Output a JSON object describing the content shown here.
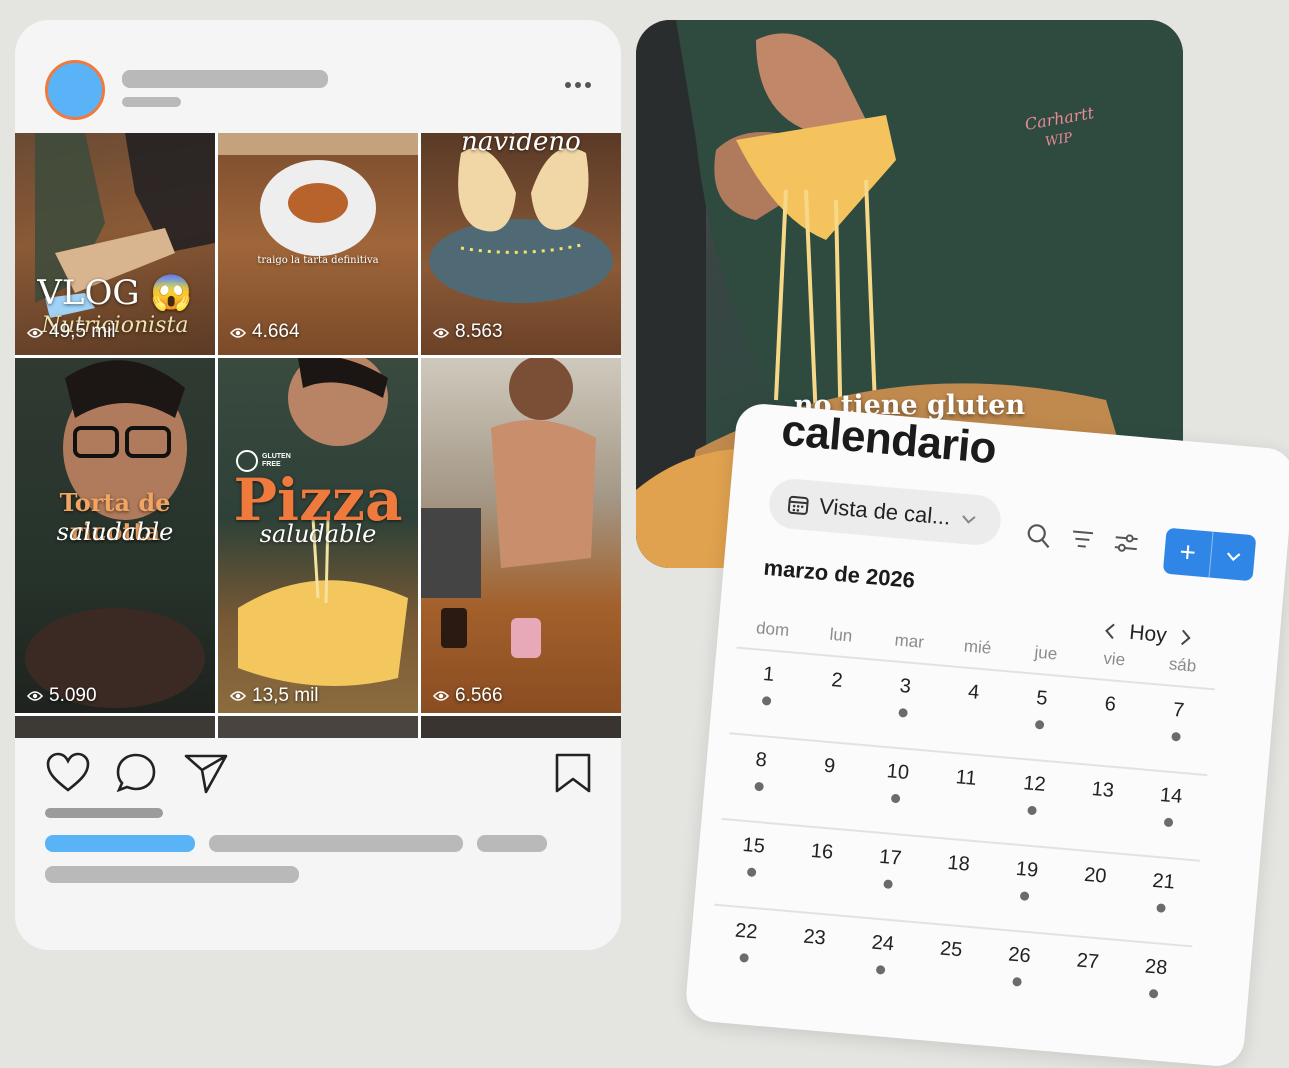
{
  "instagram_post": {
    "tiles": [
      {
        "caption": "VLOG 😱",
        "caption2": "Nutricionista",
        "views": "49,5 mil"
      },
      {
        "caption": "traigo la tarta definitiva",
        "caption2": "",
        "views": "4.664"
      },
      {
        "caption": "navideño",
        "caption2": "",
        "views": "8.563"
      },
      {
        "caption": "Torta de ricotta",
        "caption2": "saludable",
        "views": "5.090"
      },
      {
        "caption": "Pizza",
        "caption2": "saludable",
        "badge": "GLUTEN FREE",
        "views": "13,5 mil"
      },
      {
        "caption": "",
        "caption2": "",
        "views": "6.566"
      }
    ],
    "icons": [
      "heart-icon",
      "comment-icon",
      "share-icon",
      "bookmark-icon",
      "more-icon",
      "eye-icon"
    ],
    "colors": {
      "avatar": "#5ab3f7",
      "avatar_ring": "#f07a3e",
      "link_placeholder": "#5ab3f7"
    }
  },
  "video": {
    "caption": "no tiene gluten",
    "shirt_logo": "Carhartt WIP"
  },
  "calendar": {
    "title": "calendario",
    "view_selector": "Vista de cal...",
    "month": "marzo de 2026",
    "today_button": "Hoy",
    "add_button": "+",
    "accent": "#2f86e6",
    "weekdays": [
      "dom",
      "lun",
      "mar",
      "mié",
      "jue",
      "vie",
      "sáb"
    ],
    "weeks": [
      [
        {
          "d": "1",
          "dot": true
        },
        {
          "d": "2",
          "dot": false
        },
        {
          "d": "3",
          "dot": true
        },
        {
          "d": "4",
          "dot": false
        },
        {
          "d": "5",
          "dot": true
        },
        {
          "d": "6",
          "dot": false
        },
        {
          "d": "7",
          "dot": true
        }
      ],
      [
        {
          "d": "8",
          "dot": true
        },
        {
          "d": "9",
          "dot": false
        },
        {
          "d": "10",
          "dot": true
        },
        {
          "d": "11",
          "dot": false
        },
        {
          "d": "12",
          "dot": true
        },
        {
          "d": "13",
          "dot": false
        },
        {
          "d": "14",
          "dot": true
        }
      ],
      [
        {
          "d": "15",
          "dot": true
        },
        {
          "d": "16",
          "dot": false
        },
        {
          "d": "17",
          "dot": true
        },
        {
          "d": "18",
          "dot": false
        },
        {
          "d": "19",
          "dot": true
        },
        {
          "d": "20",
          "dot": false
        },
        {
          "d": "21",
          "dot": true
        }
      ],
      [
        {
          "d": "22",
          "dot": true
        },
        {
          "d": "23",
          "dot": false
        },
        {
          "d": "24",
          "dot": true
        },
        {
          "d": "25",
          "dot": false
        },
        {
          "d": "26",
          "dot": true
        },
        {
          "d": "27",
          "dot": false
        },
        {
          "d": "28",
          "dot": true
        }
      ]
    ]
  }
}
